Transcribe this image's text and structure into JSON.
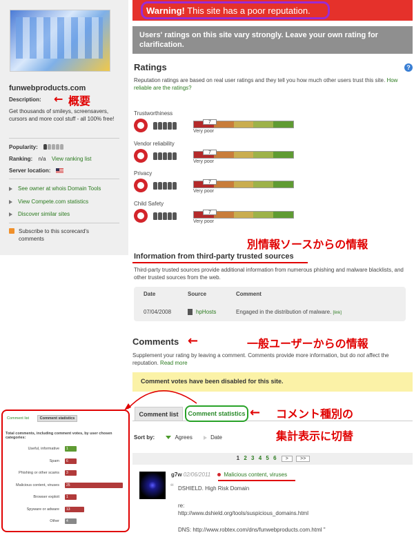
{
  "warning": {
    "strong": "Warning!",
    "text": "This site has a poor reputation."
  },
  "notice": "Users' ratings on this site vary strongly. Leave your own rating for clarification.",
  "sidebar": {
    "domain": "funwebproducts.com",
    "description_label": "Description:",
    "description": "Get thousands of smileys, screensavers, cursors and more cool stuff - all 100% free!",
    "popularity_label": "Popularity:",
    "ranking_label": "Ranking:",
    "ranking_value": "n/a",
    "ranking_link": "View ranking list",
    "server_label": "Server location:",
    "links": [
      "See owner at whois Domain Tools",
      "View Compete.com statistics",
      "Discover similar sites"
    ],
    "subscribe": "Subscribe to this scorecard's comments"
  },
  "annotations": {
    "overview": "概要",
    "third_party": "別情報ソースからの情報",
    "users": "一般ユーザーからの情報",
    "toggle_line1": "コメント種別の",
    "toggle_line2": "集計表示に切替"
  },
  "ratings": {
    "title": "Ratings",
    "intro": "Reputation ratings are based on real user ratings and they tell you how much other users trust this site.",
    "intro_link": "How reliable are the ratings?",
    "items": [
      {
        "label": "Trustworthiness",
        "value": "7",
        "verdict": "Very poor"
      },
      {
        "label": "Vendor reliability",
        "value": "7",
        "verdict": "Very poor"
      },
      {
        "label": "Privacy",
        "value": "7",
        "verdict": "Very poor"
      },
      {
        "label": "Child Safety",
        "value": "7",
        "verdict": "Very poor"
      }
    ]
  },
  "third_party": {
    "title": "Information from third-party trusted sources",
    "intro": "Third-party trusted sources provide additional information from numerous phishing and malware blacklists, and other trusted sources from the web.",
    "headers": [
      "Date",
      "Source",
      "Comment"
    ],
    "row": {
      "date": "07/04/2008",
      "source": "hpHosts",
      "comment": "Engaged in the distribution of malware.",
      "link": "[link]"
    }
  },
  "comments": {
    "title": "Comments",
    "intro_a": "Supplement your rating by leaving a comment. Comments provide more information, but do ",
    "intro_not": "not",
    "intro_b": " affect the reputation.",
    "read_more": "Read more",
    "disabled": "Comment votes have been disabled for this site.",
    "tab_list": "Comment list",
    "tab_stats": "Comment statistics",
    "sort_label": "Sort by:",
    "sort_agrees": "Agrees",
    "sort_date": "Date",
    "pages": [
      "1",
      "2",
      "3",
      "4",
      "5",
      "6"
    ],
    "next": ">",
    "last": ">>",
    "entry": {
      "user": "g7w",
      "date": "02/06/2011",
      "category": "Malicious content, viruses",
      "line1": "DSHIELD. High Risk Domain",
      "line2": "re:",
      "line3": "http://www.dshield.org/tools/suspicious_domains.html",
      "line4": "DNS: http://www.robtex.com/dns/funwebproducts.com.html \""
    }
  },
  "inset": {
    "tab_list": "Comment list",
    "tab_stats": "Comment statistics",
    "title": "Total comments, including comment votes, by user chosen categories:",
    "rows": [
      {
        "label": "Useful, informative",
        "count": "1",
        "fraction": 0.2,
        "color": "green"
      },
      {
        "label": "Spam",
        "count": "6",
        "fraction": 0.2,
        "color": "red"
      },
      {
        "label": "Phishing or other scams",
        "count": "3",
        "fraction": 0.2,
        "color": "red"
      },
      {
        "label": "Malicious content, viruses",
        "count": "25",
        "fraction": 1.0,
        "color": "red"
      },
      {
        "label": "Browser exploit",
        "count": "1",
        "fraction": 0.2,
        "color": "red"
      },
      {
        "label": "Spyware or adware",
        "count": "13",
        "fraction": 0.33,
        "color": "red"
      },
      {
        "label": "Other",
        "count": "4",
        "fraction": 0.2,
        "color": "gray"
      }
    ]
  }
}
